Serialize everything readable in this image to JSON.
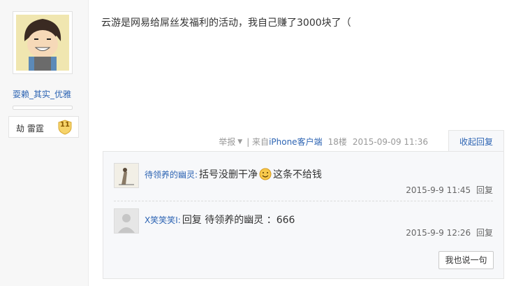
{
  "author": {
    "username": "耍赖_其实_优雅",
    "level_title": "劫 雷霆",
    "level_num": "11"
  },
  "post": {
    "content": "云游是网易给屌丝发福利的活动，我自己赚了3000块了（",
    "report_label": "举报",
    "source_prefix": "| 来自",
    "source_client": "iPhone客户端",
    "floor": "18楼",
    "timestamp": "2015-09-09 11:36",
    "collapse_label": "收起回复"
  },
  "replies": [
    {
      "name": "待领养的幽灵:",
      "text_before": "括号没删干净",
      "emoji": "smiley-icon",
      "text_after": "这条不给钱",
      "time": "2015-9-9 11:45",
      "reply_label": "回复"
    },
    {
      "name": "X笑笑笑I:",
      "text_before": "回复 待领养的幽灵 ：666",
      "time": "2015-9-9 12:26",
      "reply_label": "回复"
    }
  ],
  "say_button": "我也说一句",
  "colors": {
    "link": "#2d64b3",
    "meta": "#999999",
    "panel_bg": "#f7f8fa"
  }
}
